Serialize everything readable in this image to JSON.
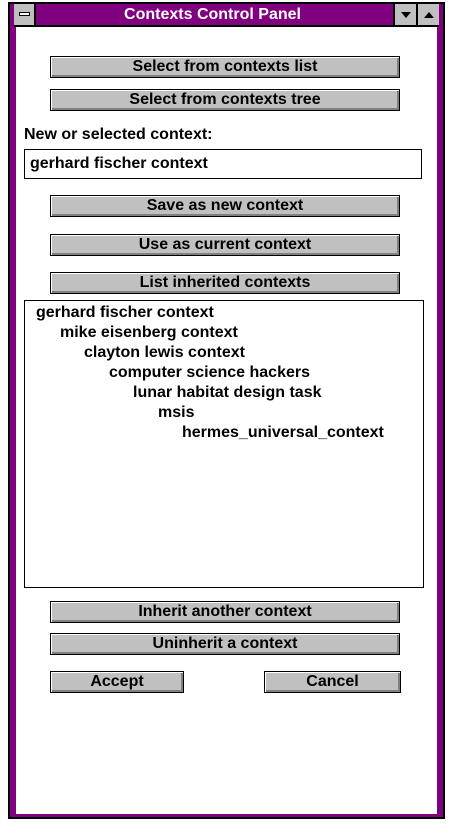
{
  "window": {
    "title": "Contexts Control Panel",
    "title_bar_color": "#800080",
    "face_color": "#c0c0c0"
  },
  "buttons": {
    "select_list": "Select from contexts list",
    "select_tree": "Select from contexts tree",
    "save_new": "Save as new context",
    "use_current": "Use as current context",
    "list_inherited": "List inherited contexts",
    "inherit_another": "Inherit another context",
    "uninherit": "Uninherit a context",
    "accept": "Accept",
    "cancel": "Cancel"
  },
  "context_field": {
    "label": "New or selected context:",
    "value": "gerhard fischer context"
  },
  "inherited_list": {
    "items": [
      {
        "label": "gerhard fischer context",
        "depth": 0
      },
      {
        "label": "mike eisenberg context",
        "depth": 1
      },
      {
        "label": "clayton lewis context",
        "depth": 2
      },
      {
        "label": "computer science hackers",
        "depth": 3
      },
      {
        "label": "lunar habitat design task",
        "depth": 4
      },
      {
        "label": "msis",
        "depth": 5
      },
      {
        "label": "hermes_universal_context",
        "depth": 6
      }
    ]
  }
}
